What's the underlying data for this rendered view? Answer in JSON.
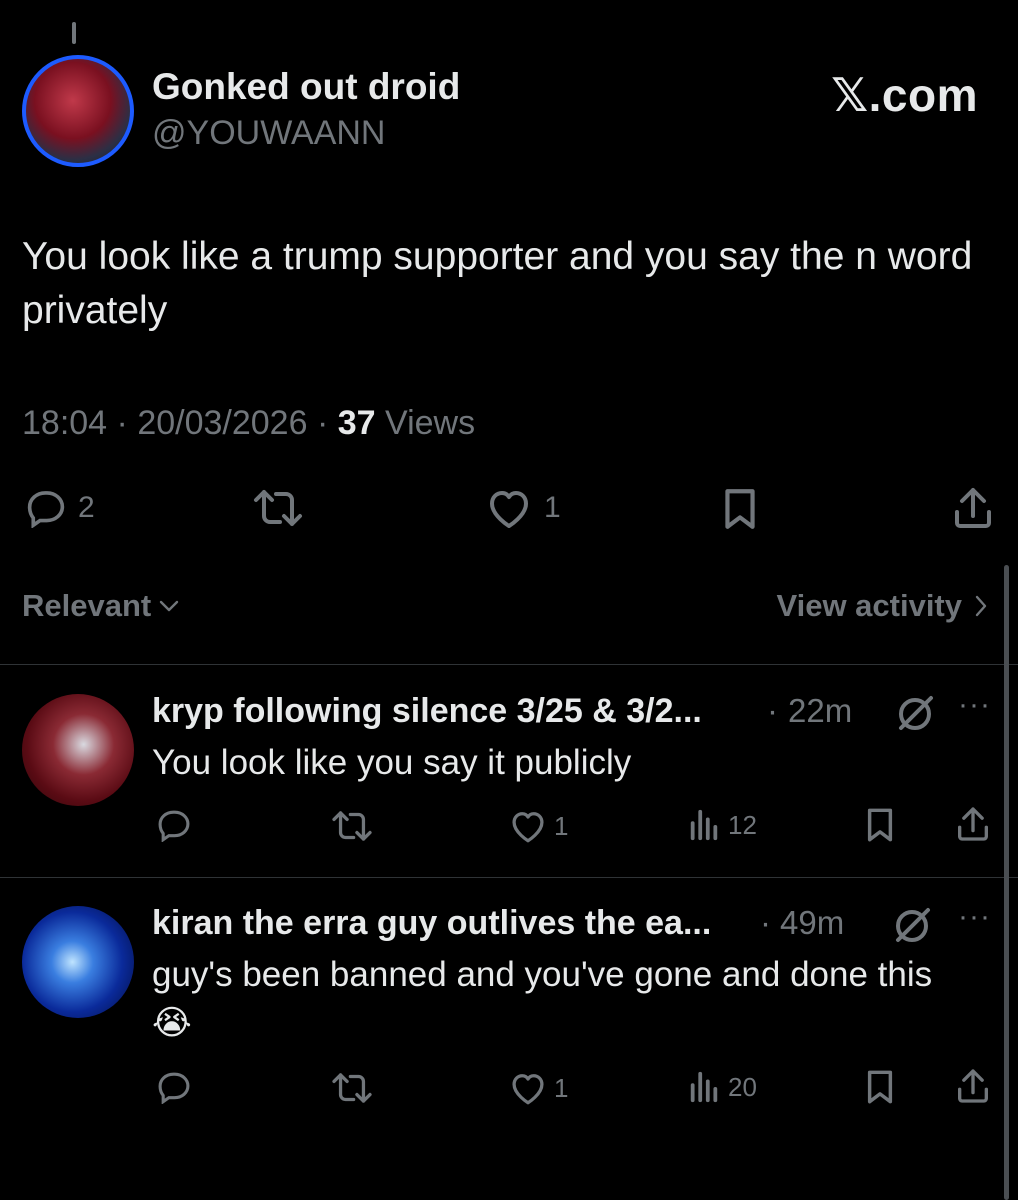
{
  "tweet": {
    "display_name": "Gonked out droid",
    "handle": "@YOUWAANN",
    "brand": "𝕏.com",
    "text": "You look like a trump supporter and you say the n word privately",
    "time": "18:04",
    "date": "20/03/2026",
    "views_count": "37",
    "views_label": "Views",
    "replies": "2",
    "likes": "1"
  },
  "toolbar": {
    "sort_label": "Relevant",
    "view_activity_label": "View activity"
  },
  "replies": [
    {
      "name": "kryp following silence 3/25 & 3/2...",
      "time": "22m",
      "text": "You look like you say it publicly",
      "likes": "1",
      "views": "12"
    },
    {
      "name": "kiran the erra guy outlives the ea...",
      "time": "49m",
      "text": "guy's been banned and you've gone and done this",
      "emoji": "😭",
      "likes": "1",
      "views": "20"
    }
  ],
  "colors": {
    "background": "#000000",
    "text": "#e7e9ea",
    "muted": "#71767b",
    "avatar_ring": "#1d5bff"
  }
}
